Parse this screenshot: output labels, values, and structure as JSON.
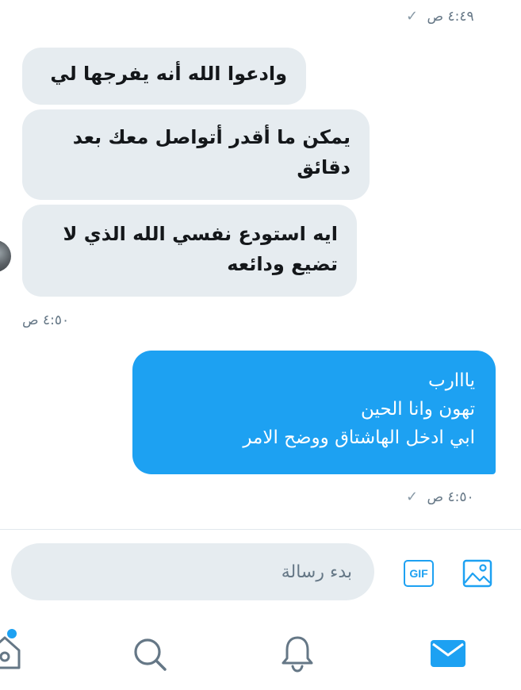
{
  "thread": {
    "timestamp_top": "٤:٤٩ ص",
    "incoming_messages": [
      {
        "text": "وادعوا الله أنه يفرجها لي"
      },
      {
        "text": "يمكن ما أقدر أتواصل معك بعد\nدقائق"
      },
      {
        "text": "ايه استودع نفسي الله الذي لا\nتضيع ودائعه"
      }
    ],
    "timestamp_incoming": "٤:٥٠ ص",
    "outgoing_message": {
      "text": "يااارب\nتهون وانا الحين\nابي ادخل الهاشتاق ووضح الامر"
    },
    "timestamp_outgoing": "٤:٥٠ ص"
  },
  "composer": {
    "placeholder": "بدء رسالة",
    "gif_label": "GIF"
  },
  "colors": {
    "accent": "#1da1f2",
    "incoming_bubble": "#e6ecf0",
    "timestamp": "#657786"
  },
  "icons": {
    "read_check": "check-icon",
    "gif": "gif-icon",
    "media": "image-icon",
    "nav": [
      "home-icon",
      "search-icon",
      "bell-icon",
      "mail-icon"
    ]
  }
}
